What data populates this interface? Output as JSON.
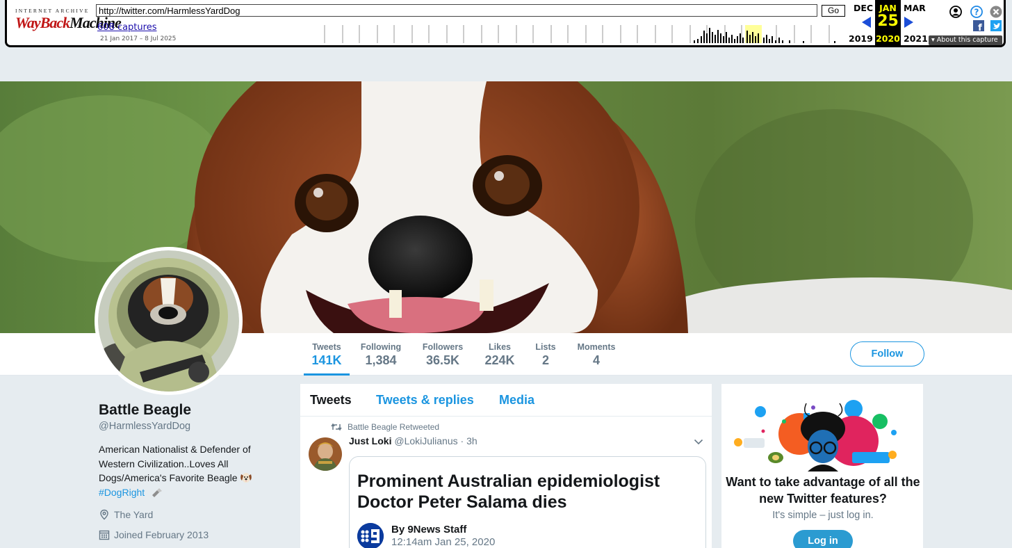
{
  "wayback": {
    "ia_label": "INTERNET ARCHIVE",
    "logo_text_red": "WayBack",
    "logo_text_dark": "Machine",
    "url": "http://twitter.com/HarmlessYardDog",
    "go_label": "Go",
    "captures": "608 captures",
    "range": "21 Jan 2017 – 8 Jul 2025",
    "prev_month": "DEC",
    "cur_month": "JAN",
    "next_month": "MAR",
    "cur_day": "25",
    "prev_year": "2019",
    "cur_year": "2020",
    "next_year": "2021",
    "about": "About this capture",
    "icons": [
      "user-icon",
      "help-icon",
      "close-icon",
      "facebook-icon",
      "twitter-icon"
    ]
  },
  "stats": [
    {
      "label": "Tweets",
      "value": "141K"
    },
    {
      "label": "Following",
      "value": "1,384"
    },
    {
      "label": "Followers",
      "value": "36.5K"
    },
    {
      "label": "Likes",
      "value": "224K"
    },
    {
      "label": "Lists",
      "value": "2"
    },
    {
      "label": "Moments",
      "value": "4"
    }
  ],
  "follow_label": "Follow",
  "profile": {
    "name": "Battle Beagle",
    "handle": "@HarmlessYardDog",
    "bio_line1": "American Nationalist & Defender of",
    "bio_line2": "Western Civilization..Loves All",
    "bio_line3": "Dogs/America's Favorite Beagle",
    "bio_tag": "#DogRight",
    "location": "The Yard",
    "joined": "Joined February 2013"
  },
  "timeline": {
    "tabs": [
      "Tweets",
      "Tweets & replies",
      "Media"
    ],
    "retweet_label": "Battle Beagle Retweeted",
    "tweet": {
      "name": "Just Loki",
      "handle": "@LokiJulianus",
      "time": "3h",
      "headline": "Prominent Australian epidemiologist Doctor Peter Salama dies",
      "source_byline": "By 9News Staff",
      "source_date": "12:14am Jan 25, 2020"
    }
  },
  "promo": {
    "title": "Want to take advantage of all the new Twitter features?",
    "subtitle": "It's simple – just log in.",
    "login_label": "Log in"
  },
  "colors": {
    "accent": "#1b95e0",
    "page_bg": "#e6ecf0",
    "wayback_red": "#c01616"
  }
}
